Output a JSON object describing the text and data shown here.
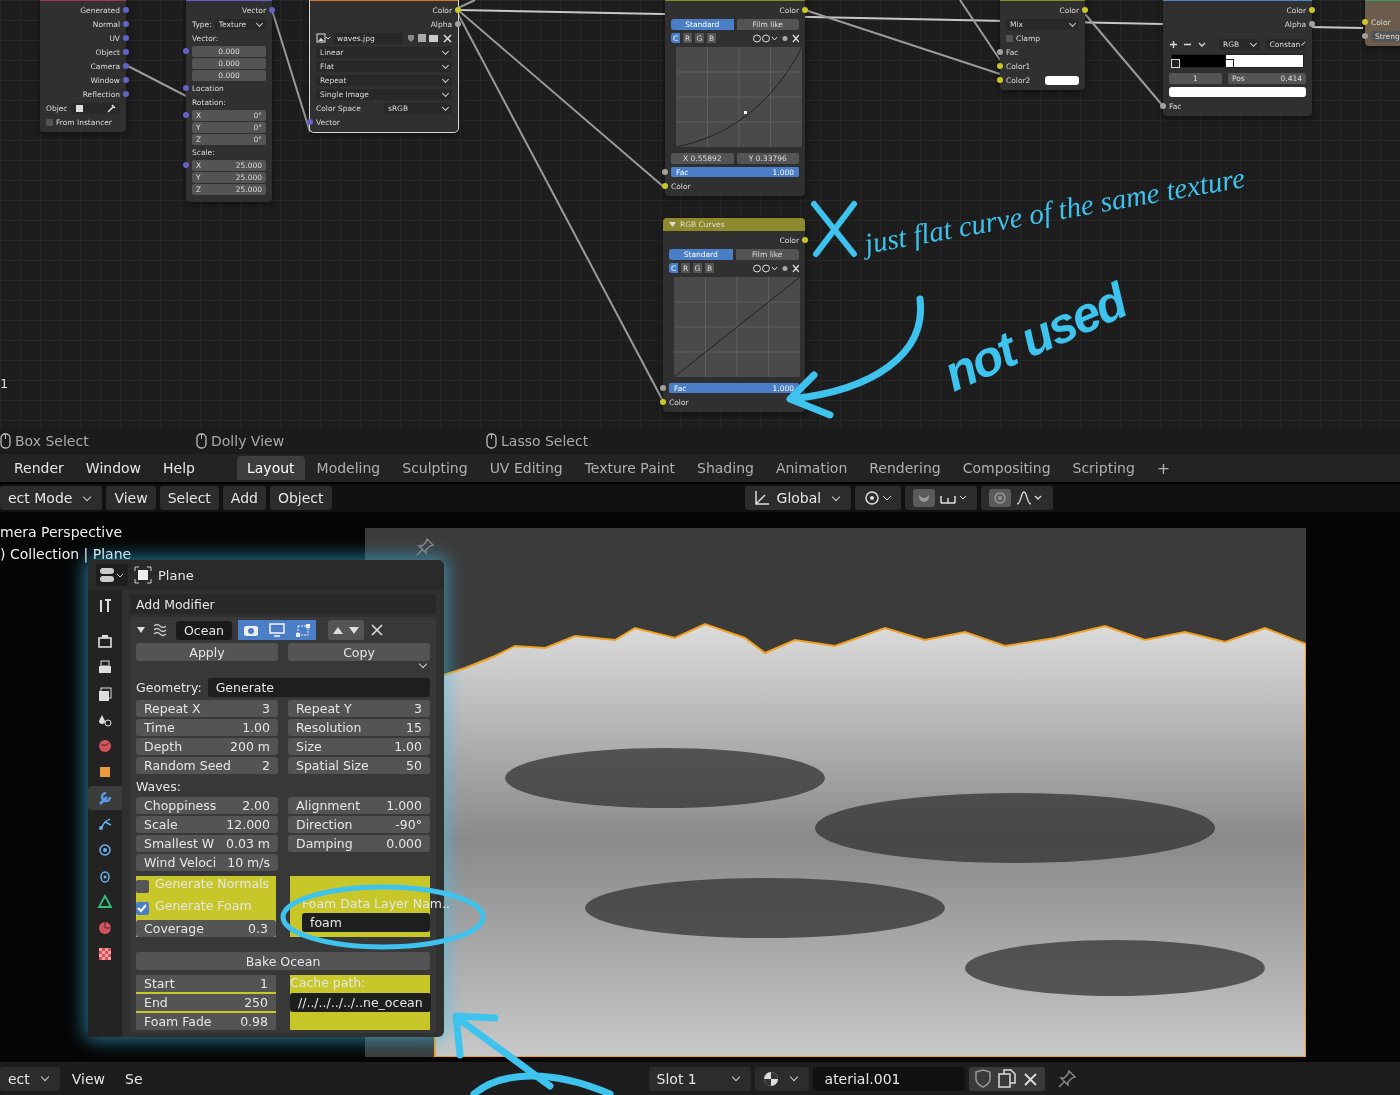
{
  "node_editor": {
    "coordinate_node": {
      "outputs": [
        "Generated",
        "Normal",
        "UV",
        "Object",
        "Camera",
        "Window",
        "Reflection"
      ],
      "object_label": "Objec",
      "from_instancer": {
        "label": "From Instancer",
        "checked": false
      }
    },
    "mapping_node": {
      "output": "Vector",
      "type_label": "Type:",
      "type_value": "Texture",
      "vector_label": "Vector:",
      "vector_values": [
        "0.000",
        "0.000",
        "0.000"
      ],
      "location_label": "Location",
      "rotation_label": "Rotation:",
      "rotation": [
        {
          "axis": "X",
          "value": "0°"
        },
        {
          "axis": "Y",
          "value": "0°"
        },
        {
          "axis": "Z",
          "value": "0°"
        }
      ],
      "scale_label": "Scale:",
      "scale": [
        {
          "axis": "X",
          "value": "25.000"
        },
        {
          "axis": "Y",
          "value": "25.000"
        },
        {
          "axis": "Z",
          "value": "25.000"
        }
      ]
    },
    "image_node": {
      "outputs": [
        "Color",
        "Alpha"
      ],
      "image": "waves.jpg",
      "dropdowns": [
        "Linear",
        "Flat",
        "Repeat",
        "Single Image"
      ],
      "color_space_label": "Color Space",
      "color_space": "sRGB",
      "input": "Vector"
    },
    "curves_nodes": [
      {
        "kind": "curved",
        "output": "Color",
        "modes": [
          {
            "label": "Standard",
            "selected": true
          },
          {
            "label": "Film like",
            "selected": false
          }
        ],
        "channels": [
          {
            "label": "C",
            "selected": true
          },
          {
            "label": "R",
            "selected": false
          },
          {
            "label": "G",
            "selected": false
          },
          {
            "label": "B",
            "selected": false
          }
        ],
        "point": {
          "x": "X 0.55892",
          "y": "Y 0.33796"
        },
        "fac": {
          "label": "Fac",
          "value": "1.000",
          "level": 1
        },
        "input": "Color"
      },
      {
        "kind": "linear",
        "title": "RGB Curves",
        "output": "Color",
        "modes": [
          {
            "label": "Standard",
            "selected": true
          },
          {
            "label": "Film like",
            "selected": false
          }
        ],
        "channels": [
          {
            "label": "C",
            "selected": true
          },
          {
            "label": "R",
            "selected": false
          },
          {
            "label": "G",
            "selected": false
          },
          {
            "label": "B",
            "selected": false
          }
        ],
        "fac": {
          "label": "Fac",
          "value": "1.000",
          "level": 1
        },
        "input": "Color"
      }
    ],
    "mix_node": {
      "output": "Color",
      "blend": "Mix",
      "clamp": {
        "label": "Clamp",
        "checked": false
      },
      "inputs": [
        "Fac",
        "Color1",
        "Color2"
      ]
    },
    "ramp_node": {
      "outputs": [
        "Color",
        "Alpha"
      ],
      "mode": "RGB",
      "interpolation": "Constan",
      "level": 0.414,
      "stop_index": "1",
      "pos_label": "Pos",
      "pos_value": "0.414",
      "input": "Fac"
    },
    "emission_node": {
      "input": "Color",
      "field": "Streng"
    },
    "edge_label": "1"
  },
  "annotations": [
    "just flat curve of the same texture",
    "not used"
  ],
  "status_hints": [
    "Box Select",
    "Dolly View",
    "Lasso Select"
  ],
  "menus": [
    "Render",
    "Window",
    "Help"
  ],
  "workspaces": [
    {
      "label": "Layout",
      "selected": true
    },
    {
      "label": "Modeling",
      "selected": false
    },
    {
      "label": "Sculpting",
      "selected": false
    },
    {
      "label": "UV Editing",
      "selected": false
    },
    {
      "label": "Texture Paint",
      "selected": false
    },
    {
      "label": "Shading",
      "selected": false
    },
    {
      "label": "Animation",
      "selected": false
    },
    {
      "label": "Rendering",
      "selected": false
    },
    {
      "label": "Compositing",
      "selected": false
    },
    {
      "label": "Scripting",
      "selected": false
    }
  ],
  "add_workspace": "+",
  "viewport_header": {
    "mode": "ect Mode",
    "menus": [
      "View",
      "Select",
      "Add",
      "Object"
    ],
    "orientation": "Global"
  },
  "viewport": {
    "overlay_lines": [
      "mera Perspective",
      ") Collection | Plane"
    ]
  },
  "properties": {
    "object": "Plane",
    "add_modifier": "Add Modifier",
    "modifier_name": "Ocean",
    "toggles": [
      {
        "kind": "camera",
        "on": true
      },
      {
        "kind": "display",
        "on": true
      },
      {
        "kind": "editmode",
        "on": true
      }
    ],
    "apply": "Apply",
    "copy": "Copy",
    "geometry_label": "Geometry:",
    "geometry": "Generate",
    "geometry_fields": [
      {
        "label": "Repeat X",
        "value": "3"
      },
      {
        "label": "Repeat Y",
        "value": "3"
      },
      {
        "label": "Time",
        "value": "1.00"
      },
      {
        "label": "Resolution",
        "value": "15"
      },
      {
        "label": "Depth",
        "value": "200 m"
      },
      {
        "label": "Size",
        "value": "1.00"
      },
      {
        "label": "Random Seed",
        "value": "2"
      },
      {
        "label": "Spatial Size",
        "value": "50"
      }
    ],
    "waves_label": "Waves:",
    "wave_fields": [
      {
        "label": "Choppiness",
        "value": "2.00"
      },
      {
        "label": "Alignment",
        "value": "1.000"
      },
      {
        "label": "Scale",
        "value": "12.000"
      },
      {
        "label": "Direction",
        "value": "-90°"
      },
      {
        "label": "Smallest W",
        "value": "0.03 m"
      },
      {
        "label": "Damping",
        "value": "0.000"
      },
      {
        "label": "Wind Veloci",
        "value": "10 m/s"
      }
    ],
    "generate_normals": {
      "label": "Generate Normals",
      "checked": false
    },
    "generate_foam": {
      "label": "Generate Foam",
      "checked": true
    },
    "coverage": {
      "label": "Coverage",
      "value": "0.3"
    },
    "foam_layer": {
      "label": "Foam Data Layer Nam..",
      "value": "foam"
    },
    "bake": "Bake Ocean",
    "frames": [
      {
        "label": "Start",
        "value": "1"
      },
      {
        "label": "End",
        "value": "250"
      },
      {
        "label": "Foam Fade",
        "value": "0.98"
      }
    ],
    "cache_path": {
      "label": "Cache path:",
      "value": "//../../../../..ne_ocean"
    },
    "tabs": [
      {
        "kind": "tool",
        "selected": false
      },
      {
        "kind": "render",
        "selected": false
      },
      {
        "kind": "output",
        "selected": false
      },
      {
        "kind": "view_layer",
        "selected": false
      },
      {
        "kind": "scene",
        "selected": false
      },
      {
        "kind": "world",
        "selected": false
      },
      {
        "kind": "object",
        "selected": false
      },
      {
        "kind": "modifiers",
        "selected": true
      },
      {
        "kind": "particles",
        "selected": false
      },
      {
        "kind": "physics",
        "selected": false
      },
      {
        "kind": "constraints",
        "selected": false
      },
      {
        "kind": "data",
        "selected": false
      },
      {
        "kind": "material",
        "selected": false
      },
      {
        "kind": "texture",
        "selected": false
      }
    ]
  },
  "footer": {
    "mode": "ect",
    "menus": [
      "View",
      "Se"
    ],
    "slot": "Slot 1",
    "material": "aterial.001"
  }
}
